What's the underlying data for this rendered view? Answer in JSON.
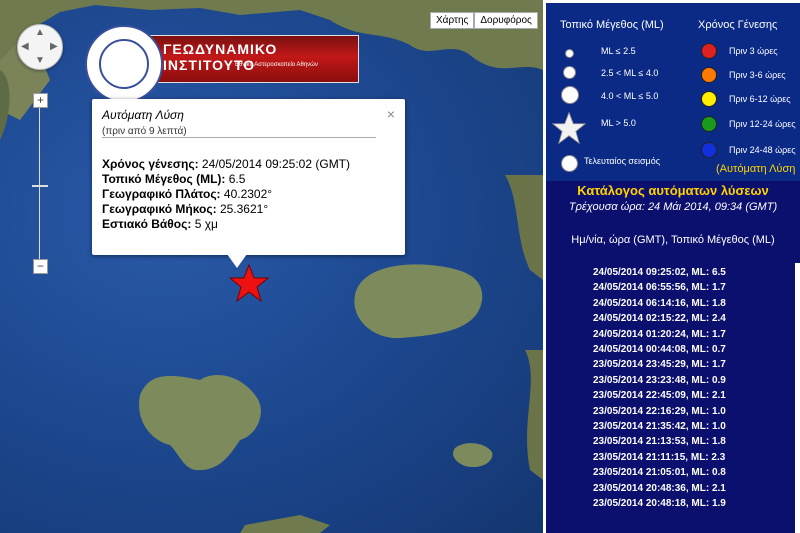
{
  "map": {
    "map_type_buttons": [
      "Χάρτης",
      "Δορυφόρος"
    ],
    "zoom_in": "+",
    "zoom_out": "−",
    "pan_arrows": {
      "up": "▲",
      "down": "▼",
      "left": "◀",
      "right": "▶"
    }
  },
  "logo": {
    "title": "ΓΕΩΔΥΝΑΜΙΚΟ ΙΝΣΤΙΤΟΥΤΟ",
    "subtitle": "Εθνικό Αστεροσκοπείο Αθηνών"
  },
  "info_window": {
    "title": "Αυτόματη Λύση",
    "subtitle": "(πριν από 9 λεπτά)",
    "close": "×",
    "fields": [
      {
        "label": "Χρόνος γένεσης:",
        "value": "24/05/2014  09:25:02 (GMT)"
      },
      {
        "label": "Τοπικό Μέγεθος (ML):",
        "value": "6.5"
      },
      {
        "label": "Γεωγραφικό Πλάτος:",
        "value": "40.2302°"
      },
      {
        "label": "Γεωγραφικό Μήκος:",
        "value": "25.3621°"
      },
      {
        "label": "Εστιακό Βάθος:",
        "value": "5 χμ"
      }
    ]
  },
  "legend": {
    "magnitude_header": "Τοπικό Μέγεθος (ML)",
    "time_header": "Χρόνος Γένεσης",
    "magnitudes": [
      "ML ≤ 2.5",
      "2.5 < ML ≤ 4.0",
      "4.0 < ML ≤ 5.0",
      "ML > 5.0"
    ],
    "latest": "Τελευταίος σεισμός",
    "times": [
      {
        "label": "Πριν 3 ώρες",
        "color": "#e02020"
      },
      {
        "label": "Πριν 3-6 ώρες",
        "color": "#ff7a00"
      },
      {
        "label": "Πριν 6-12 ώρες",
        "color": "#ffee00"
      },
      {
        "label": "Πριν 12-24 ώρες",
        "color": "#1a9a1a"
      },
      {
        "label": "Πριν 24-48 ώρες",
        "color": "#1030e0"
      }
    ],
    "auto_note": "(Αυτόματη Λύση"
  },
  "catalog": {
    "title": "Κατάλογος αυτόματων λύσεων",
    "current_time": "Τρέχουσα ώρα: 24 Μάι 2014, 09:34 (GMT)",
    "header": "Ημ/νία, ώρα (GMT), Τοπικό Μέγεθος (ML)",
    "events": [
      "24/05/2014 09:25:02,  ML: 6.5",
      "24/05/2014 06:55:56,  ML: 1.7",
      "24/05/2014 06:14:16,  ML: 1.8",
      "24/05/2014 02:15:22,  ML: 2.4",
      "24/05/2014 01:20:24,  ML: 1.7",
      "24/05/2014 00:44:08,  ML: 0.7",
      "23/05/2014 23:45:29,  ML: 1.7",
      "23/05/2014 23:23:48,  ML: 0.9",
      "23/05/2014 22:45:09,  ML: 2.1",
      "23/05/2014 22:16:29,  ML: 1.0",
      "23/05/2014 21:35:42,  ML: 1.0",
      "23/05/2014 21:13:53,  ML: 1.8",
      "23/05/2014 21:11:15,  ML: 2.3",
      "23/05/2014 21:05:01,  ML: 0.8",
      "23/05/2014 20:48:36,  ML: 2.1",
      "23/05/2014 20:48:18,  ML: 1.9"
    ]
  }
}
